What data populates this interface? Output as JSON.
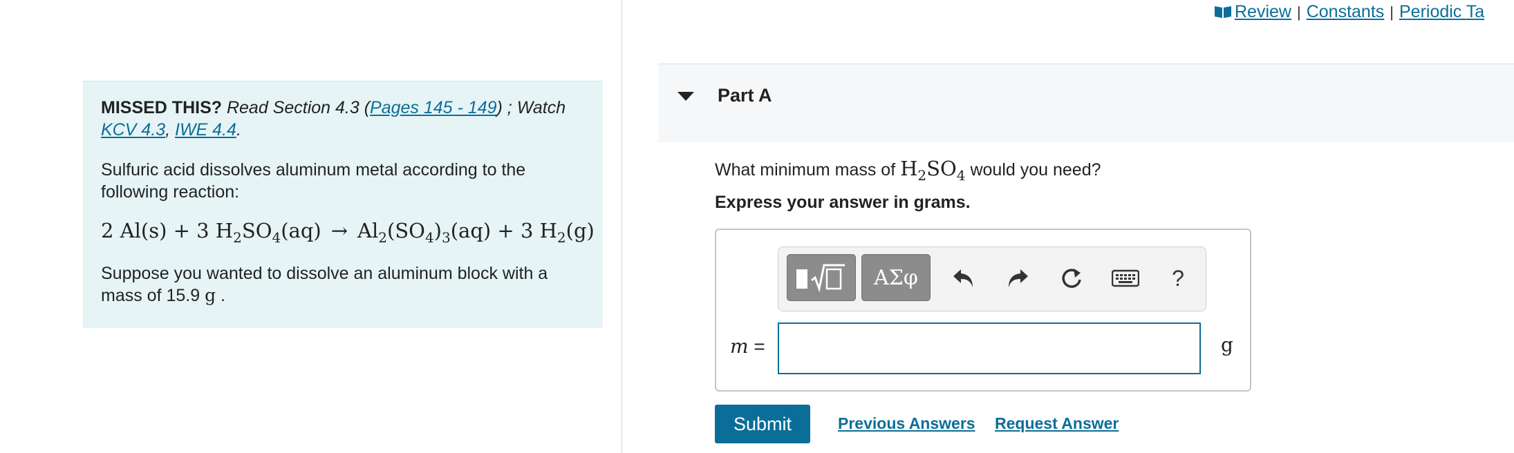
{
  "top_links": {
    "review": "Review",
    "constants": "Constants",
    "periodic_table": "Periodic Ta",
    "separator": "|"
  },
  "info": {
    "missed_label": "MISSED THIS?",
    "read_text": "Read Section 4.3 (",
    "pages_link": "Pages 145 - 149",
    "watch_text": ") ; Watch",
    "kcv_link": "KCV 4.3",
    "comma": ",",
    "iwe_link": "IWE 4.4",
    "period": ".",
    "intro": "Sulfuric acid dissolves aluminum metal according to the following reaction:",
    "equation": {
      "t1": "2 Al(s) + 3 H",
      "s1": "2",
      "t2": "SO",
      "s2": "4",
      "t3": "(aq)",
      "arrow": "→",
      "t4": "Al",
      "s3": "2",
      "t5": "(SO",
      "s4": "4",
      "t6": ")",
      "s5": "3",
      "t7": "(aq) + 3 H",
      "s6": "2",
      "t8": "(g)"
    },
    "suppose_text": "Suppose you wanted to dissolve an aluminum block with a mass of 15.9 ",
    "mass_unit": "g",
    "suppose_end": " ."
  },
  "part": {
    "title": "Part A"
  },
  "question": {
    "prefix": "What minimum mass of ",
    "h": "H",
    "h_sub": "2",
    "so": "SO",
    "so_sub": "4",
    "suffix": " would you need?",
    "instruction": "Express your answer in grams."
  },
  "toolbar": {
    "greek_label": "ΑΣφ",
    "help_label": "?"
  },
  "answer": {
    "variable": "m",
    "equals": " =",
    "value": "",
    "unit": "g"
  },
  "actions": {
    "submit": "Submit",
    "previous_answers": "Previous Answers",
    "request_answer": "Request Answer"
  },
  "colors": {
    "link": "#0b6e99",
    "info_bg": "#e6f4f5",
    "button_gray": "#8c8c8c"
  }
}
